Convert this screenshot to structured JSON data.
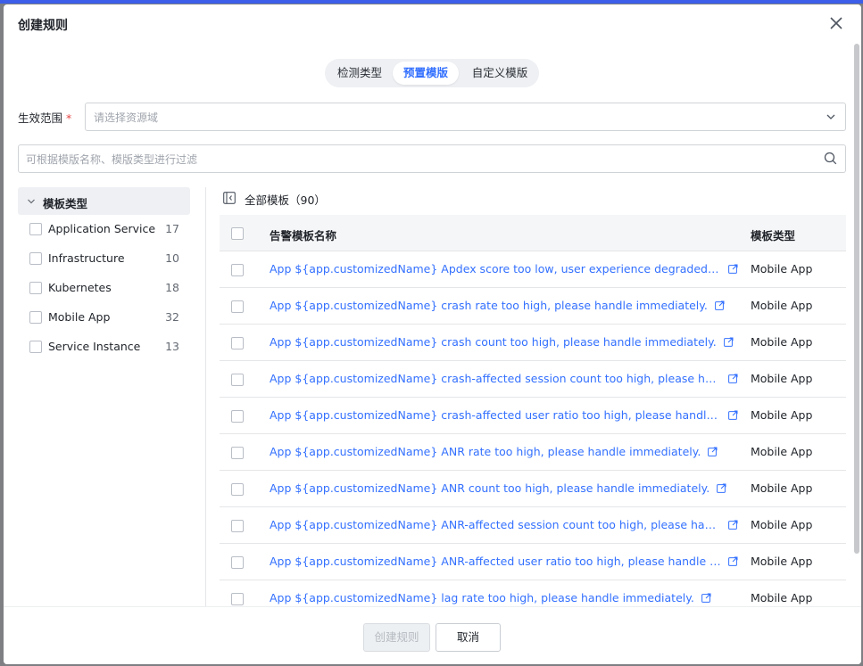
{
  "dialog": {
    "title": "创建规则"
  },
  "tabs": [
    {
      "label": "检测类型",
      "active": false
    },
    {
      "label": "预置模版",
      "active": true
    },
    {
      "label": "自定义模版",
      "active": false
    }
  ],
  "scope": {
    "label": "生效范围",
    "required_mark": "*",
    "placeholder": "请选择资源域"
  },
  "filter": {
    "placeholder": "可根据模版名称、模版类型进行过滤"
  },
  "sidebar": {
    "group_label": "模板类型",
    "items": [
      {
        "label": "Application Service",
        "count": "17"
      },
      {
        "label": "Infrastructure",
        "count": "10"
      },
      {
        "label": "Kubernetes",
        "count": "18"
      },
      {
        "label": "Mobile App",
        "count": "32"
      },
      {
        "label": "Service Instance",
        "count": "13"
      }
    ]
  },
  "main": {
    "all_label": "全部模板（90）",
    "columns": {
      "name": "告警模板名称",
      "type": "模板类型"
    },
    "rows": [
      {
        "name": "App ${app.customizedName} Apdex score too low, user experience degraded, please handle immediately.",
        "type": "Mobile App"
      },
      {
        "name": "App ${app.customizedName} crash rate too high, please handle immediately.",
        "type": "Mobile App"
      },
      {
        "name": "App ${app.customizedName} crash count too high, please handle immediately.",
        "type": "Mobile App"
      },
      {
        "name": "App ${app.customizedName} crash-affected session count too high, please handle immediately.",
        "type": "Mobile App"
      },
      {
        "name": "App ${app.customizedName} crash-affected user ratio too high, please handle immediately.",
        "type": "Mobile App"
      },
      {
        "name": "App ${app.customizedName} ANR rate too high, please handle immediately.",
        "type": "Mobile App"
      },
      {
        "name": "App ${app.customizedName} ANR count too high, please handle immediately.",
        "type": "Mobile App"
      },
      {
        "name": "App ${app.customizedName} ANR-affected session count too high, please handle immediately.",
        "type": "Mobile App"
      },
      {
        "name": "App ${app.customizedName} ANR-affected user ratio too high, please handle immediately.",
        "type": "Mobile App"
      },
      {
        "name": "App ${app.customizedName} lag rate too high, please handle immediately.",
        "type": "Mobile App"
      }
    ]
  },
  "footer": {
    "create_label": "创建规则",
    "cancel_label": "取消"
  },
  "icons": {
    "close": "close-icon",
    "select": "chevron-down-icon",
    "search": "search-icon",
    "collapse": "collapse-panel-icon",
    "external": "external-link-icon"
  },
  "colors": {
    "accent": "#3370ff",
    "required": "#e54545"
  }
}
